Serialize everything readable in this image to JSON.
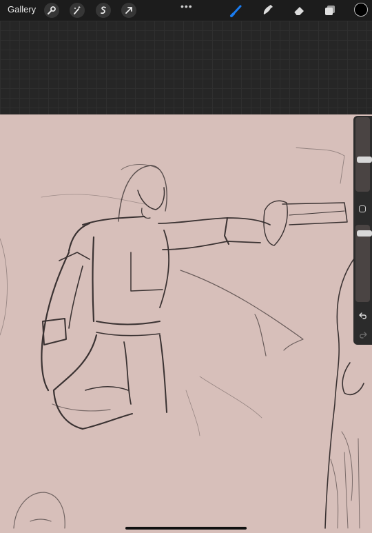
{
  "toolbar": {
    "gallery_label": "Gallery",
    "left_tools": [
      "wrench-icon",
      "magic-wand-icon",
      "selection-icon",
      "transform-arrow-icon"
    ],
    "more_label": "•••",
    "right_tools": [
      "brush-icon",
      "smudge-icon",
      "eraser-icon",
      "layers-icon"
    ],
    "active_tool": "brush-icon",
    "active_color": "#1a7cf0",
    "current_color": "#000000"
  },
  "canvas": {
    "paper_color": "#d7bfba",
    "sketch_color": "#3a3232"
  },
  "sidebar": {
    "brush_size_level": 0.35,
    "opacity_level": 0.12
  }
}
